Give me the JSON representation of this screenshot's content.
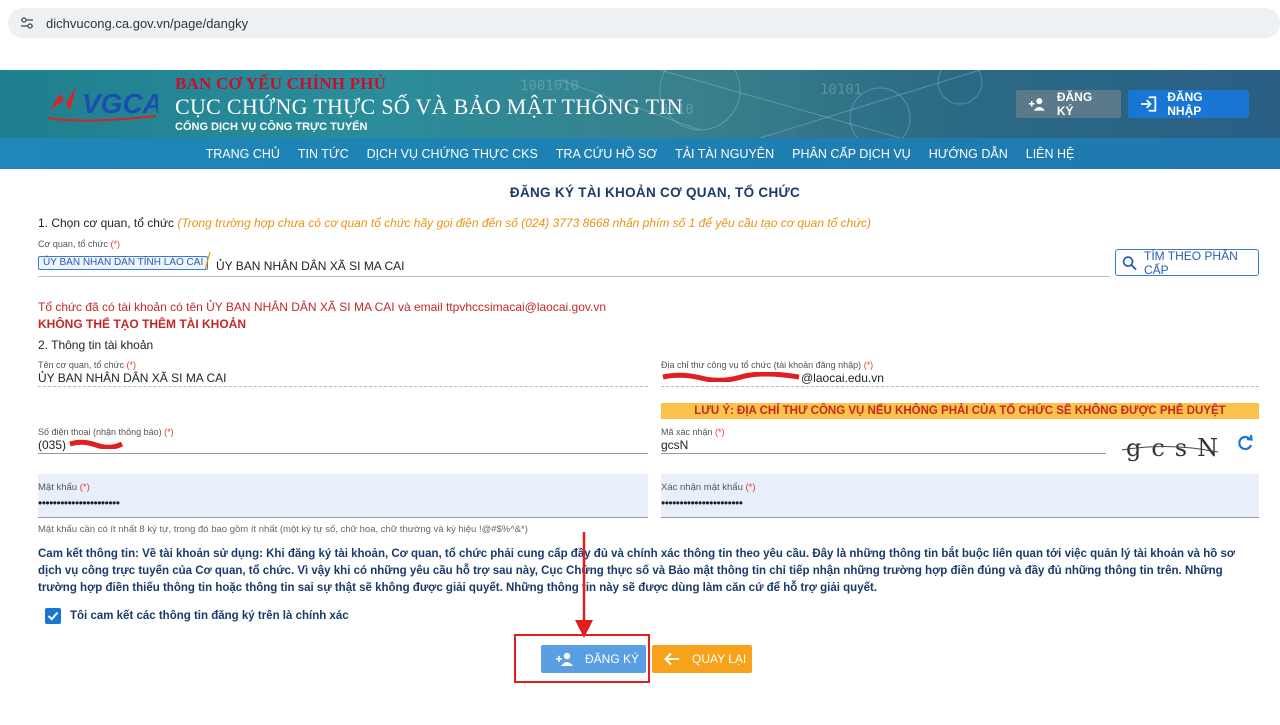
{
  "browser": {
    "url": "dichvucong.ca.gov.vn/page/dangky"
  },
  "header": {
    "gov_line1": "BAN CƠ YẾU CHÍNH PHỦ",
    "gov_line2": "CỤC CHỨNG THỰC SỐ VÀ BẢO MẬT THÔNG TIN",
    "gov_line3": "CỔNG DỊCH VỤ CÔNG TRỰC TUYẾN",
    "logo_text": "VGCA",
    "register_label": "ĐĂNG KÝ",
    "login_label": "ĐĂNG NHẬP"
  },
  "nav": {
    "items": [
      "TRANG CHỦ",
      "TIN TỨC",
      "DỊCH VỤ CHỨNG THỰC CKS",
      "TRA CỨU HỒ SƠ",
      "TẢI TÀI NGUYÊN",
      "PHÂN CẤP DỊCH VỤ",
      "HƯỚNG DẪN",
      "LIÊN HỆ"
    ]
  },
  "form": {
    "title": "ĐĂNG KÝ TÀI KHOẢN CƠ QUAN, TỔ CHỨC",
    "step1_label": "1. Chọn cơ quan, tổ chức",
    "step1_hint": "(Trong trường hợp chưa có cơ quan tổ chức hãy gọi điện đến số (024) 3773 8668 nhấn phím số 1 để yêu cầu tạo cơ quan tổ chức)",
    "org_label": "Cơ quan, tổ chức",
    "required_mark": "(*)",
    "org_parent_chip": "ỦY BAN NHÂN DÂN TỈNH LÀO CAI",
    "org_value": "ỦY BAN NHÂN DÂN XÃ SI MA CAI",
    "search_button": "TÌM THEO PHÂN CẤP",
    "error_exists": "Tổ chức đã có tài khoản có tên ỦY BAN NHÂN DÂN XÃ SI MA CAI và email ttpvhccsimacai@laocai.gov.vn",
    "error_cannot": "KHÔNG THỂ TẠO THÊM TÀI KHOẢN",
    "step2_label": "2. Thông tin tài khoản",
    "name_label": "Tên cơ quan, tổ chức",
    "name_value": "ỦY BAN NHÂN DÂN XÃ SI MA CAI",
    "email_label": "Địa chỉ thư công vụ tổ chức (tài khoản đăng nhập)",
    "email_value_suffix": "@laocai.edu.vn",
    "warning": "LƯU Ý: ĐỊA CHỈ THƯ CÔNG VỤ NẾU KHÔNG PHẢI CỦA TỔ CHỨC SẼ KHÔNG ĐƯỢC PHÊ DUYỆT",
    "phone_label": "Số điện thoại (nhận thông báo)",
    "phone_value_prefix": "(035)",
    "captcha_label": "Mã xác nhận",
    "captcha_value": "gcsN",
    "captcha_image_text": "gcsN",
    "password_label": "Mật khẩu",
    "password_value": "••••••••••••••••••••••",
    "confirm_label": "Xác nhận mật khẩu",
    "confirm_value": "••••••••••••••••••••••",
    "password_hint": "Mật khẩu cần có ít nhất 8 ký tự, trong đó bao gồm ít nhất (một ký tự số, chữ hoa, chữ thường và ký hiệu !@#$%^&*)",
    "commitment": "Cam kết thông tin: Về tài khoản sử dụng: Khi đăng ký tài khoản, Cơ quan, tổ chức phải cung cấp đầy đủ và chính xác thông tin theo yêu cầu. Đây là những thông tin bắt buộc liên quan tới việc quản lý tài khoản và hồ sơ dịch vụ công trực tuyến của Cơ quan, tổ chức. Vì vậy khi có những yêu cầu hỗ trợ sau này, Cục Chứng thực số và Bảo mật thông tin chỉ tiếp nhận những trường hợp điền đúng và đầy đủ những thông tin trên. Những trường hợp điền thiếu thông tin hoặc thông tin sai sự thật sẽ không được giải quyết. Những thông tin này sẽ được dùng làm căn cứ để hỗ trợ giải quyết.",
    "agree_label": "Tôi cam kết các thông tin đăng ký trên là chính xác",
    "agree_checked": true,
    "submit_label": "ĐĂNG KÝ",
    "back_label": "QUAY LẠI"
  },
  "colors": {
    "accent": "#1976d2",
    "warning_bg": "#fcc34a",
    "error": "#c62828",
    "back_button": "#f7a21b",
    "annotation": "#e02020"
  }
}
